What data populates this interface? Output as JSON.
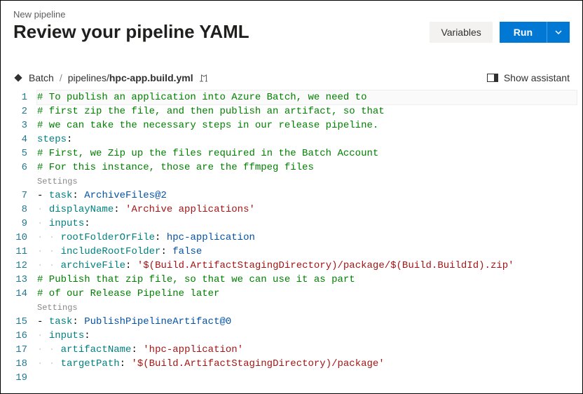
{
  "header": {
    "breadcrumb": "New pipeline",
    "title": "Review your pipeline YAML",
    "variables_label": "Variables",
    "run_label": "Run"
  },
  "filebar": {
    "repo": "Batch",
    "path_prefix": "pipelines/",
    "file": "hpc-app.build.yml",
    "assistant_label": "Show assistant"
  },
  "editor": {
    "settings_label": "Settings",
    "lines": [
      {
        "n": 1,
        "type": "comment",
        "text": "# To publish an application into Azure Batch, we need to"
      },
      {
        "n": 2,
        "type": "comment",
        "text": "# first zip the file, and then publish an artifact, so that"
      },
      {
        "n": 3,
        "type": "comment",
        "text": "# we can take the necessary steps in our release pipeline."
      },
      {
        "n": 4,
        "type": "key",
        "key": "steps",
        "val": ""
      },
      {
        "n": 5,
        "type": "comment",
        "text": "# First, we Zip up the files required in the Batch Account"
      },
      {
        "n": 6,
        "type": "comment",
        "text": "# For this instance, those are the ffmpeg files"
      },
      {
        "type": "settings"
      },
      {
        "n": 7,
        "type": "task",
        "indent": 0,
        "dash": true,
        "key": "task",
        "val": "ArchiveFiles@2"
      },
      {
        "n": 8,
        "type": "kv",
        "indent": 1,
        "key": "displayName",
        "str": "'Archive applications'"
      },
      {
        "n": 9,
        "type": "key",
        "indent": 1,
        "key": "inputs"
      },
      {
        "n": 10,
        "type": "kv",
        "indent": 2,
        "key": "rootFolderOrFile",
        "val": "hpc-application"
      },
      {
        "n": 11,
        "type": "kv",
        "indent": 2,
        "key": "includeRootFolder",
        "val": "false"
      },
      {
        "n": 12,
        "type": "kv",
        "indent": 2,
        "key": "archiveFile",
        "str": "'$(Build.ArtifactStagingDirectory)/package/$(Build.BuildId).zip'"
      },
      {
        "n": 13,
        "type": "comment",
        "text": "# Publish that zip file, so that we can use it as part"
      },
      {
        "n": 14,
        "type": "comment",
        "text": "# of our Release Pipeline later"
      },
      {
        "type": "settings"
      },
      {
        "n": 15,
        "type": "task",
        "indent": 0,
        "dash": true,
        "key": "task",
        "val": "PublishPipelineArtifact@0"
      },
      {
        "n": 16,
        "type": "key",
        "indent": 1,
        "key": "inputs"
      },
      {
        "n": 17,
        "type": "kv",
        "indent": 2,
        "key": "artifactName",
        "str": "'hpc-application'"
      },
      {
        "n": 18,
        "type": "kv",
        "indent": 2,
        "key": "targetPath",
        "str": "'$(Build.ArtifactStagingDirectory)/package'"
      },
      {
        "n": 19,
        "type": "blank"
      }
    ]
  }
}
